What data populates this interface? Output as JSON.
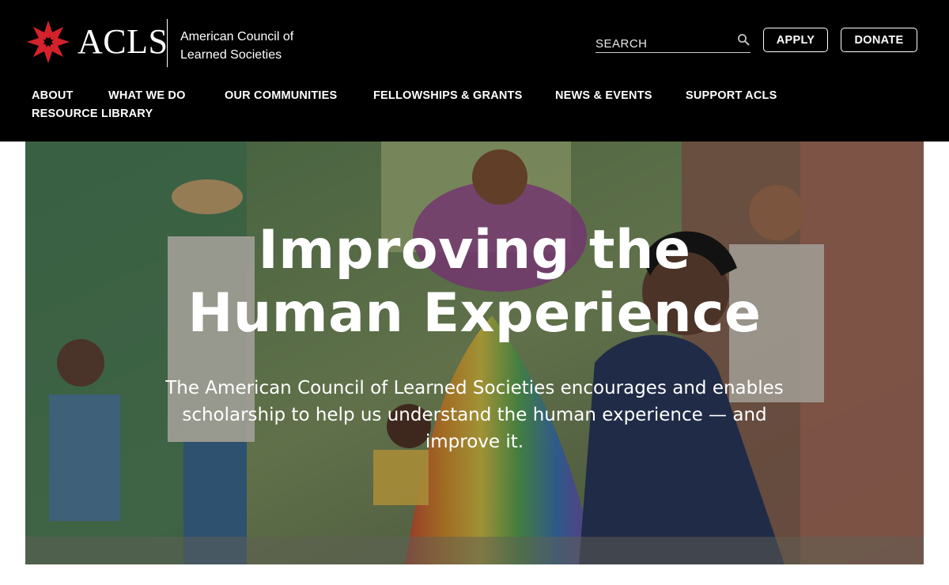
{
  "header": {
    "logo_text": "ACLS",
    "org_name": "American Council of Learned Societies",
    "search": {
      "placeholder": "SEARCH"
    },
    "buttons": {
      "apply": "APPLY",
      "donate": "DONATE"
    }
  },
  "nav": {
    "items": [
      {
        "label": "ABOUT"
      },
      {
        "label": "WHAT WE DO"
      },
      {
        "label": "OUR COMMUNITIES"
      },
      {
        "label": "FELLOWSHIPS & GRANTS"
      },
      {
        "label": "NEWS & EVENTS"
      },
      {
        "label": "SUPPORT ACLS"
      },
      {
        "label": "RESOURCE LIBRARY"
      }
    ]
  },
  "hero": {
    "title_line1": "Improving the",
    "title_line2": "Human Experience",
    "subtitle": "The American Council of Learned Societies encourages and enables scholarship to help us understand the human experience — and improve it."
  },
  "colors": {
    "header_bg": "#000000",
    "logo_red": "#d4222c",
    "text_on_dark": "#ffffff"
  },
  "icons": {
    "logo": "red-star-flower-icon",
    "search": "search-icon"
  }
}
